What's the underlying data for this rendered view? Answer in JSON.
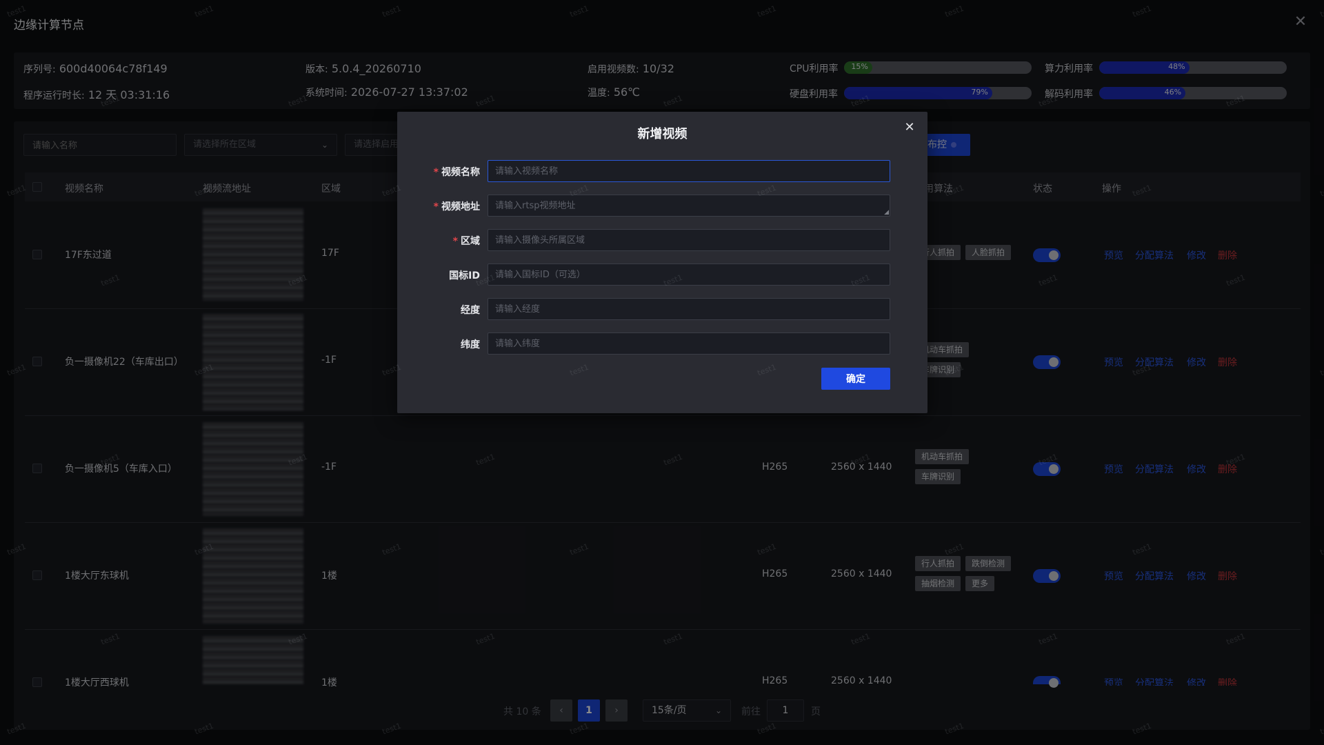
{
  "page": {
    "title": "边缘计算节点",
    "close_icon": "close-icon"
  },
  "stats": {
    "serial_label": "序列号:",
    "serial_value": "600d40064c78f149",
    "runtime_label": "程序运行时长:",
    "runtime_value": "12 天 03:31:16",
    "version_label": "版本:",
    "version_value": "5.0.4_20260710",
    "systime_label": "系统时间:",
    "systime_value": "2026-07-27 13:37:02",
    "videos_label": "启用视频数:",
    "videos_value": "10/32",
    "temp_label": "温度:",
    "temp_value": "56℃",
    "meters": [
      {
        "label": "CPU利用率",
        "percent": 15,
        "text": "15%",
        "color": "#2f6d2a"
      },
      {
        "label": "算力利用率",
        "percent": 48,
        "text": "48%",
        "color": "#1d2bb3"
      },
      {
        "label": "硬盘利用率",
        "percent": 79,
        "text": "79%",
        "color": "#1d2bb3"
      },
      {
        "label": "解码利用率",
        "percent": 46,
        "text": "46%",
        "color": "#1d2bb3"
      }
    ]
  },
  "filters": {
    "name_placeholder": "请输入名称",
    "region_placeholder": "请选择所在区域",
    "algo_placeholder": "请选择启用",
    "deploy_label": "布控"
  },
  "table": {
    "headers": {
      "name": "视频名称",
      "url": "视频流地址",
      "region": "区域",
      "algos": "用算法",
      "status": "状态",
      "ops": "操作"
    },
    "op_labels": {
      "preview": "预览",
      "assign": "分配算法",
      "edit": "修改",
      "delete": "删除"
    },
    "rows": [
      {
        "name": "17F东过道",
        "region": "17F",
        "codec": "",
        "resolution": "",
        "tags": [
          "行人抓拍",
          "人脸抓拍"
        ],
        "enabled": true
      },
      {
        "name": "负一摄像机22（车库出口）",
        "region": "-1F",
        "codec": "",
        "resolution": "",
        "tags": [
          "机动车抓拍",
          "车牌识别"
        ],
        "enabled": true
      },
      {
        "name": "负一摄像机5（车库入口）",
        "region": "-1F",
        "codec": "H265",
        "resolution": "2560 x 1440",
        "tags": [
          "机动车抓拍",
          "车牌识别"
        ],
        "enabled": true
      },
      {
        "name": "1楼大厅东球机",
        "region": "1楼",
        "codec": "H265",
        "resolution": "2560 x 1440",
        "tags": [
          "行人抓拍",
          "跌倒检测",
          "抽烟检测",
          "更多"
        ],
        "enabled": true
      },
      {
        "name": "1楼大厅西球机",
        "region": "1楼",
        "codec": "H265",
        "resolution": "2560 x 1440",
        "tags": [],
        "enabled": true
      }
    ]
  },
  "pagination": {
    "total": "共 10 条",
    "current_page": "1",
    "page_size": "15条/页",
    "goto_label": "前往",
    "goto_value": "1",
    "page_suffix": "页"
  },
  "modal": {
    "title": "新增视频",
    "fields": [
      {
        "label": "视频名称",
        "required": true,
        "placeholder": "请输入视频名称",
        "value": ""
      },
      {
        "label": "视频地址",
        "required": true,
        "placeholder": "请输入rtsp视频地址",
        "value": ""
      },
      {
        "label": "区域",
        "required": true,
        "placeholder": "请输入摄像头所属区域",
        "value": ""
      },
      {
        "label": "国标ID",
        "required": false,
        "placeholder": "请输入国标ID（可选）",
        "value": ""
      },
      {
        "label": "经度",
        "required": false,
        "placeholder": "请输入经度",
        "value": ""
      },
      {
        "label": "纬度",
        "required": false,
        "placeholder": "请输入纬度",
        "value": ""
      }
    ],
    "confirm_label": "确定"
  },
  "watermark": "test1"
}
